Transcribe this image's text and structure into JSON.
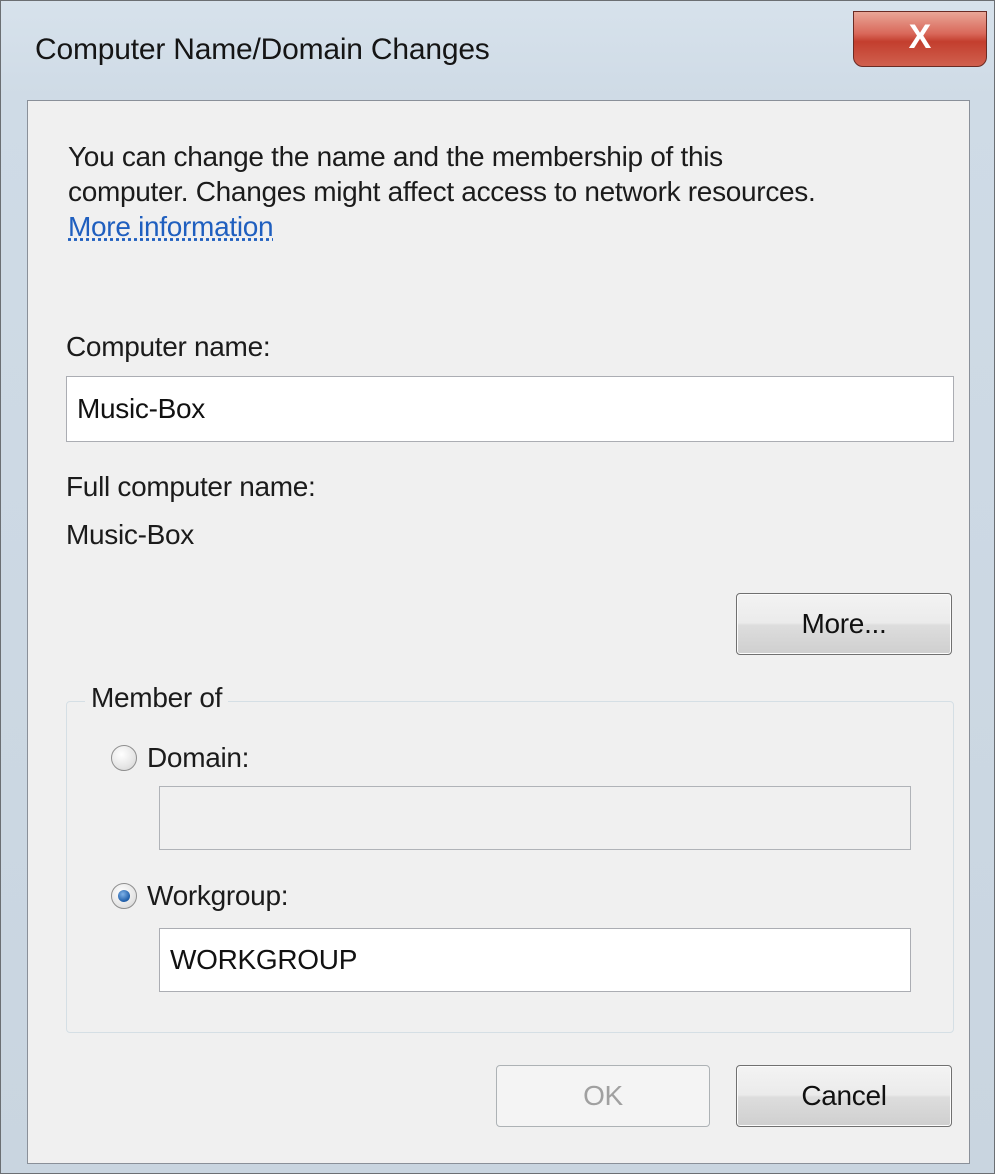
{
  "window": {
    "title": "Computer Name/Domain Changes",
    "close_glyph": "X"
  },
  "intro": {
    "line1": "You can change the name and the membership of this",
    "line2": "computer. Changes might affect access to network resources.",
    "more_info_link": "More information"
  },
  "computer_name": {
    "label": "Computer name:",
    "value": "Music-Box"
  },
  "full_computer_name": {
    "label": "Full computer name:",
    "value": "Music-Box"
  },
  "more_button": {
    "label": "More..."
  },
  "member_of": {
    "legend": "Member of",
    "domain": {
      "label": "Domain:",
      "checked": false,
      "value": "",
      "enabled": false
    },
    "workgroup": {
      "label": "Workgroup:",
      "checked": true,
      "value": "WORKGROUP"
    }
  },
  "buttons": {
    "ok_label": "OK",
    "ok_enabled": false,
    "cancel_label": "Cancel"
  },
  "colors": {
    "link": "#1f5fbf",
    "close_button": "#c33e2e",
    "frame": "#cfdbe6",
    "client_bg": "#f0f0f0"
  },
  "icons": {
    "close": "close-icon",
    "domain_radio": "radio-unchecked-icon",
    "workgroup_radio": "radio-checked-icon"
  }
}
